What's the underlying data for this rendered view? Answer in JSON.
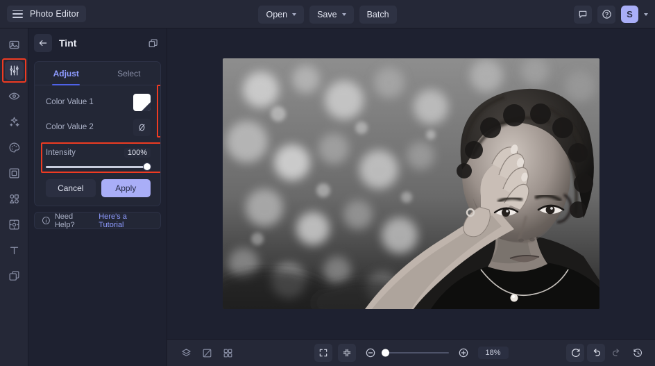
{
  "app": {
    "name": "Photo Editor",
    "menu_icon": "hamburger-icon"
  },
  "topbar": {
    "open_label": "Open",
    "save_label": "Save",
    "batch_label": "Batch",
    "feedback_icon": "comment-icon",
    "help_icon": "question-circle-icon",
    "avatar_initial": "S",
    "avatar_color": "#a9aef7"
  },
  "sidebar": {
    "items": [
      {
        "icon": "image-icon",
        "name": "sidebar-item-image",
        "active": false
      },
      {
        "icon": "sliders-icon",
        "name": "sidebar-item-adjust",
        "active": true,
        "annotated": true
      },
      {
        "icon": "eye-icon",
        "name": "sidebar-item-retouch",
        "active": false
      },
      {
        "icon": "sparkles-icon",
        "name": "sidebar-item-effects",
        "active": false
      },
      {
        "icon": "palette-icon",
        "name": "sidebar-item-color",
        "active": false
      },
      {
        "icon": "frame-icon",
        "name": "sidebar-item-frame",
        "active": false
      },
      {
        "icon": "shapes-icon",
        "name": "sidebar-item-shapes",
        "active": false
      },
      {
        "icon": "crop-icon",
        "name": "sidebar-item-crop",
        "active": false
      },
      {
        "icon": "text-icon",
        "name": "sidebar-item-text",
        "active": false
      },
      {
        "icon": "layers-icon",
        "name": "sidebar-item-layers",
        "active": false
      }
    ]
  },
  "panel": {
    "title": "Tint",
    "back_icon": "arrow-left-icon",
    "duplicate_icon": "duplicate-icon",
    "tabs": [
      {
        "label": "Adjust",
        "active": true
      },
      {
        "label": "Select",
        "active": false
      }
    ],
    "rows": [
      {
        "label": "Color Value 1",
        "swatch": "white-gradient-swatch"
      },
      {
        "label": "Color Value 2",
        "swatch": "no-color-swatch"
      }
    ],
    "intensity": {
      "label": "Intensity",
      "value": "100%",
      "percent": 100
    },
    "cancel_label": "Cancel",
    "apply_label": "Apply",
    "apply_color": "#a9aef7",
    "help": {
      "icon": "info-icon",
      "text": "Need Help?",
      "link": "Here's a Tutorial"
    }
  },
  "annotations": {
    "color": "#ef3b22",
    "boxes": [
      "sidebar-adjust-tool",
      "color-value-swatches",
      "intensity-slider"
    ]
  },
  "bottombar": {
    "left_tools": [
      {
        "icon": "layers-stack-icon",
        "name": "layers-panel-button"
      },
      {
        "icon": "compare-icon",
        "name": "compare-button"
      },
      {
        "icon": "grid-icon",
        "name": "grid-button"
      }
    ],
    "fit_icon": "fit-to-screen-icon",
    "collapse_icon": "collapse-icon",
    "zoom_out_icon": "zoom-out-icon",
    "zoom_in_icon": "zoom-in-icon",
    "zoom_value": "18%",
    "zoom_percent": 18,
    "right_tools": [
      {
        "icon": "reset-icon",
        "name": "reset-button",
        "dim": false
      },
      {
        "icon": "undo-icon",
        "name": "undo-button",
        "dim": false
      },
      {
        "icon": "redo-icon",
        "name": "redo-button",
        "dim": true
      },
      {
        "icon": "history-icon",
        "name": "history-button",
        "dim": false
      }
    ]
  },
  "canvas": {
    "image_alt": "Black and white portrait of a woman with curly hair resting hand on forehead against bokeh foliage background",
    "background": "#1e2130"
  }
}
